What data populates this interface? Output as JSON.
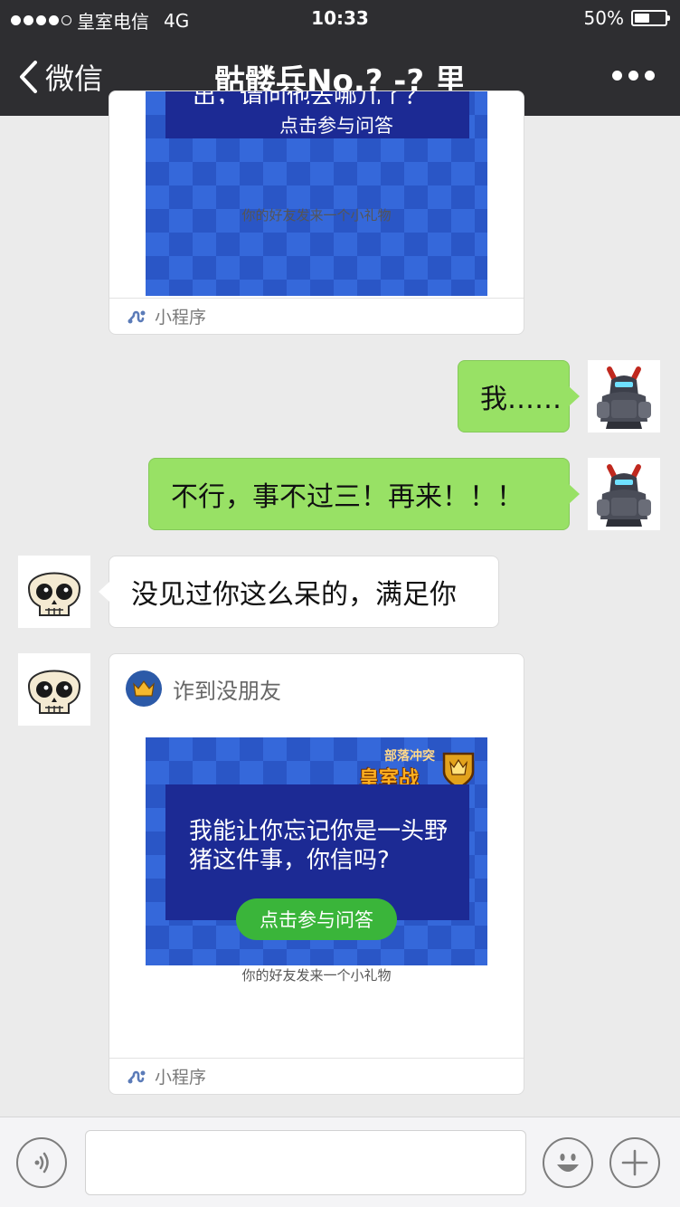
{
  "status_bar": {
    "carrier": "皇室电信",
    "network": "4G",
    "time": "10:33",
    "battery_percent": "50%",
    "battery_level": 0.5,
    "signal_bars": 4
  },
  "nav": {
    "back_label": "微信",
    "title": "骷髅兵No.? -? 里"
  },
  "messages": [
    {
      "type": "miniprogram-card",
      "from": "other",
      "partial": true,
      "question_fragment": "出，请问他去哪儿了？",
      "button_label": "点击参与问答",
      "gift_caption": "你的好友发来一个小礼物",
      "footer_label": "小程序"
    },
    {
      "type": "text",
      "from": "me",
      "text": "我……"
    },
    {
      "type": "text",
      "from": "me",
      "text": "不行，事不过三！再来！！！"
    },
    {
      "type": "text",
      "from": "other",
      "text": "没见过你这么呆的，满足你"
    },
    {
      "type": "miniprogram-card",
      "from": "other",
      "sender_name": "诈到没朋友",
      "logo_sub": "部落冲突",
      "logo_main": "皇室战争",
      "question": "我能让你忘记你是一头野猪这件事，你信吗?",
      "button_label": "点击参与问答",
      "gift_caption": "你的好友发来一个小礼物",
      "footer_label": "小程序"
    }
  ],
  "input_bar": {
    "icons": [
      "voice-icon",
      "emoji-icon",
      "plus-icon"
    ]
  },
  "colors": {
    "nav_bg": "#2e2e31",
    "chat_bg": "#ebebeb",
    "my_bubble": "#98e165",
    "other_bubble": "#ffffff",
    "quiz_button": "#3ab53a"
  }
}
